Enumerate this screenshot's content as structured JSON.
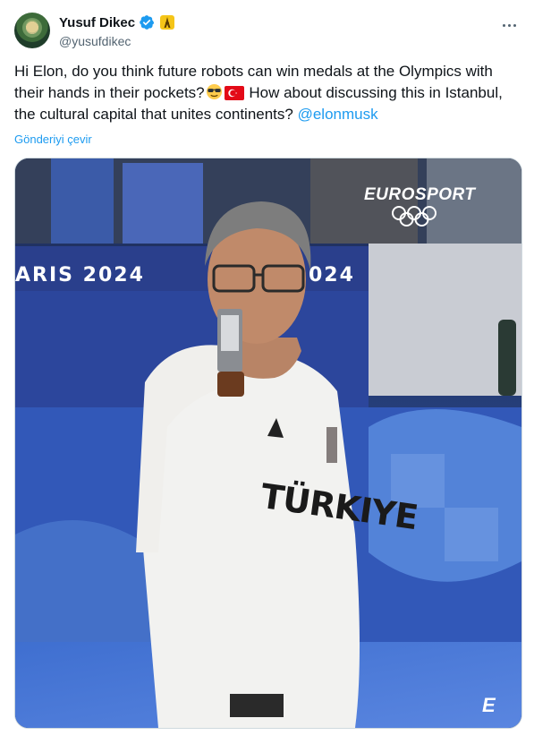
{
  "author": {
    "display_name": "Yusuf Dikec",
    "handle": "@yusufdikec",
    "verified": true,
    "badge_icon": "eiffel-tower-icon"
  },
  "tweet": {
    "text_part1": "Hi Elon, do you think future robots can win medals at the Olympics with their hands in their pockets?",
    "emoji_1": "sunglasses-emoji",
    "emoji_2": "turkey-flag-emoji",
    "text_part2": " How about discussing this in Istanbul, the cultural capital that unites continents? ",
    "mention": "@elonmusk",
    "translate_label": "Gönderiyi çevir"
  },
  "media": {
    "broadcaster": "EUROSPORT",
    "banner_left": "ARIS 2024",
    "banner_right": "024",
    "shirt_text": "TÜRKIYE",
    "corner_mark": "E"
  },
  "colors": {
    "link": "#1d9bf0",
    "verified": "#1d9bf0",
    "secondary_text": "#536471"
  }
}
